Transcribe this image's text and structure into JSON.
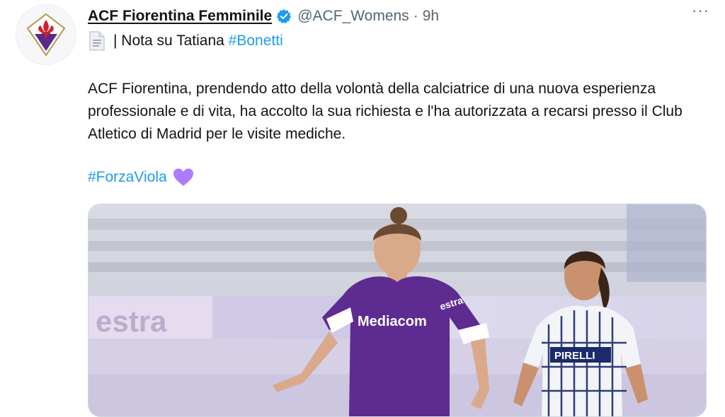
{
  "tweet": {
    "display_name": "ACF Fiorentina Femminile",
    "handle": "@ACF_Womens",
    "separator": "·",
    "time": "9h",
    "more_label": "···",
    "subtitle_prefix": "| Nota su Tatiana ",
    "subtitle_hashtag": "#Bonetti",
    "body": "ACF Fiorentina, prendendo atto della volontà della calciatrice di una nuova esperienza professionale e di vita, ha accolto la sua richiesta e l'ha autorizzata a recarsi presso il Club Atletico di Madrid per le visite mediche.",
    "hashtag": "#ForzaViola",
    "icons": {
      "avatar": "fiorentina-lily-logo",
      "verified": "verified-badge-icon",
      "document": "page-facing-up-icon",
      "heart": "purple-heart-icon"
    }
  },
  "media": {
    "jersey_sponsor": "Mediacom",
    "jersey_sleeve": "estra",
    "opponent_sponsor": "PIRELLI",
    "board_text": "estra"
  },
  "colors": {
    "link": "#1d9bf0",
    "viola": "#5b2a86",
    "heart": "#ab7df8",
    "verified": "#1d9bf0",
    "muted": "#536471"
  }
}
